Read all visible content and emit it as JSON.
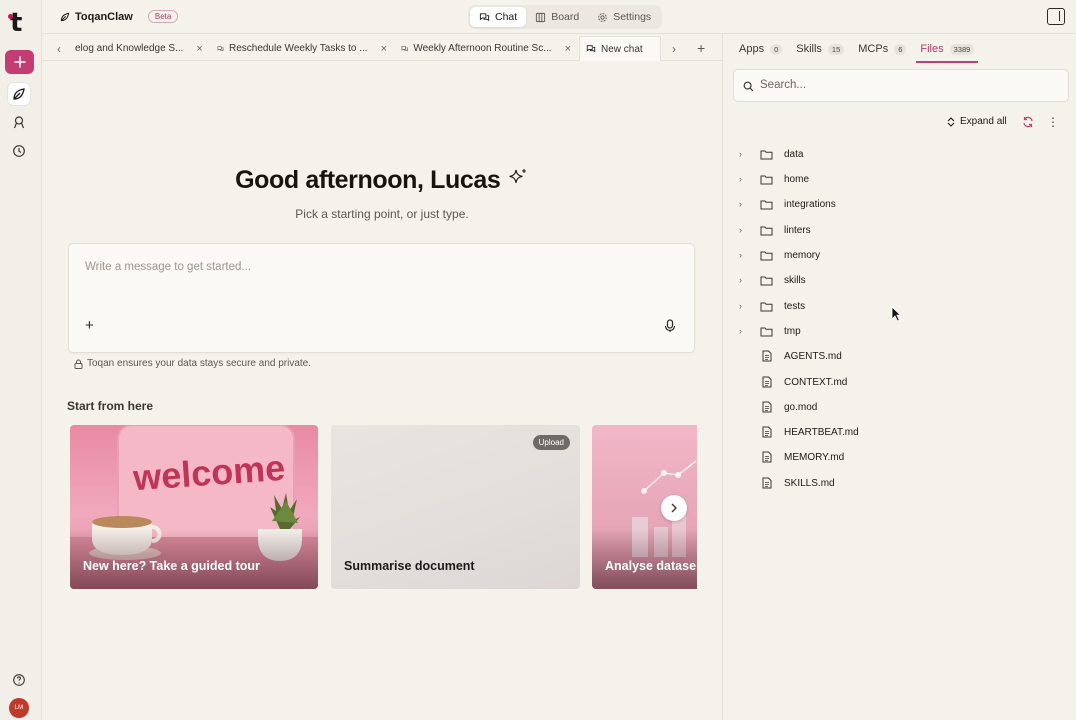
{
  "workspace": {
    "name": "ToqanClaw",
    "badge": "Beta"
  },
  "top_nav": {
    "items": [
      {
        "label": "Chat",
        "active": true
      },
      {
        "label": "Board",
        "active": false
      },
      {
        "label": "Settings",
        "active": false
      }
    ]
  },
  "tabs": [
    {
      "label": "elog and Knowledge S...",
      "active": false
    },
    {
      "label": "Reschedule Weekly Tasks to ...",
      "active": false
    },
    {
      "label": "Weekly Afternoon Routine Sc...",
      "active": false
    },
    {
      "label": "New chat",
      "active": true
    }
  ],
  "main": {
    "greeting": "Good afternoon, Lucas",
    "subtitle": "Pick a starting point, or just type.",
    "composer_placeholder": "Write a message to get started...",
    "secure_note": "Toqan ensures your data stays secure and private.",
    "start_heading": "Start from here",
    "cards": [
      {
        "title": "New here? Take a guided tour",
        "image_text": "welcome"
      },
      {
        "title": "Summarise document",
        "badge": "Upload"
      },
      {
        "title": "Analyse datase"
      }
    ]
  },
  "right_panel": {
    "tabs": [
      {
        "label": "Apps",
        "count": "0",
        "active": false
      },
      {
        "label": "Skills",
        "count": "15",
        "active": false
      },
      {
        "label": "MCPs",
        "count": "6",
        "active": false
      },
      {
        "label": "Files",
        "count": "3389",
        "active": true
      }
    ],
    "search_placeholder": "Search...",
    "expand_label": "Expand all",
    "tree": [
      {
        "name": "data",
        "type": "folder"
      },
      {
        "name": "home",
        "type": "folder"
      },
      {
        "name": "integrations",
        "type": "folder"
      },
      {
        "name": "linters",
        "type": "folder"
      },
      {
        "name": "memory",
        "type": "folder"
      },
      {
        "name": "skills",
        "type": "folder"
      },
      {
        "name": "tests",
        "type": "folder"
      },
      {
        "name": "tmp",
        "type": "folder"
      },
      {
        "name": "AGENTS.md",
        "type": "file"
      },
      {
        "name": "CONTEXT.md",
        "type": "file"
      },
      {
        "name": "go.mod",
        "type": "file"
      },
      {
        "name": "HEARTBEAT.md",
        "type": "file"
      },
      {
        "name": "MEMORY.md",
        "type": "file"
      },
      {
        "name": "SKILLS.md",
        "type": "file"
      }
    ]
  },
  "user": {
    "initials": "LM"
  },
  "colors": {
    "accent": "#c33d74",
    "background": "#f5f2ec"
  }
}
